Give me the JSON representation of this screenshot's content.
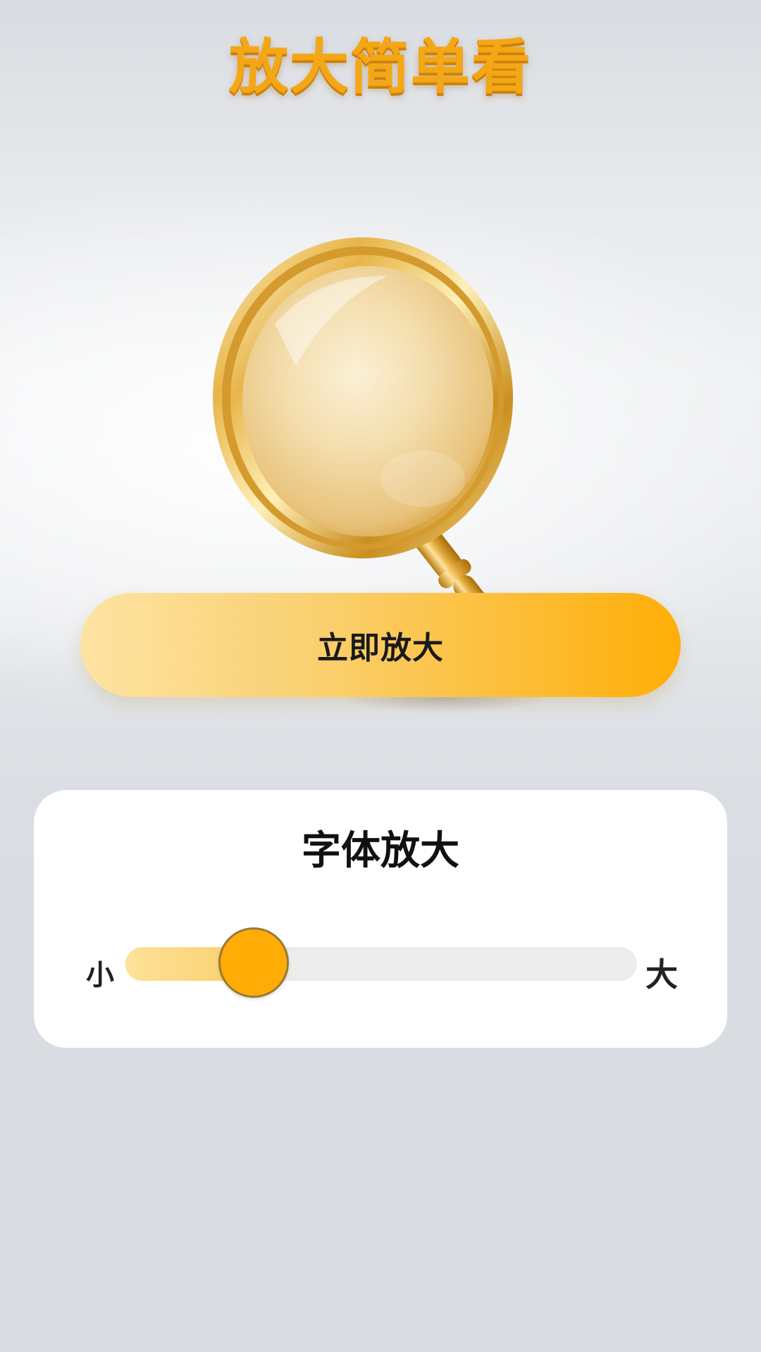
{
  "app": {
    "logo_text": "放大简单看"
  },
  "hero": {
    "illustration": "magnifying-glass"
  },
  "actions": {
    "zoom_now_label": "立即放大"
  },
  "font_card": {
    "title": "字体放大",
    "slider": {
      "min_label": "小",
      "max_label": "大",
      "value_fraction": 0.25
    }
  },
  "colors": {
    "accent": "#ffad06",
    "accent_light": "#fde3a2",
    "card_bg": "#ffffff",
    "page_bg": "#d9dde2",
    "track_bg": "#ececec"
  }
}
